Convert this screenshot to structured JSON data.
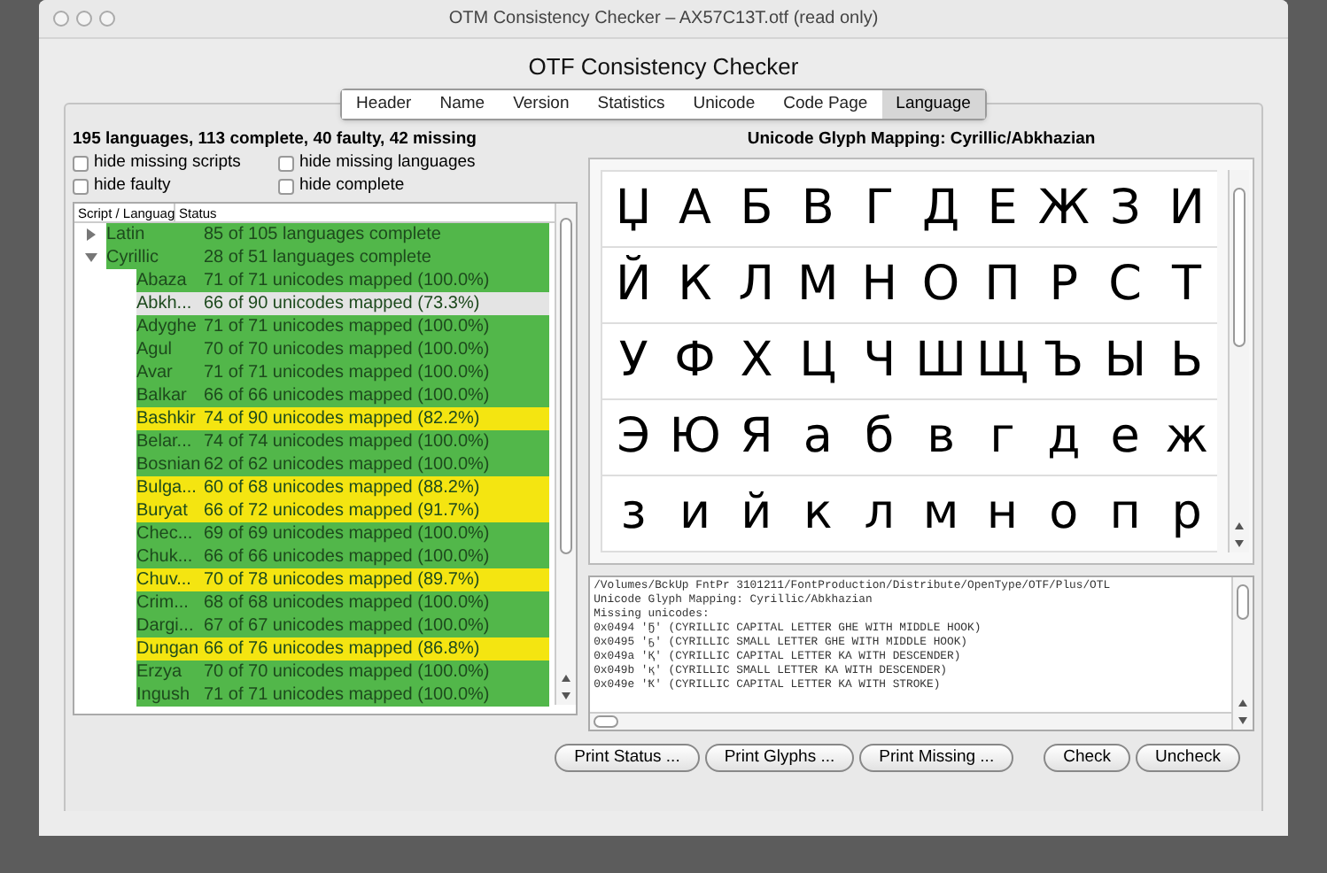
{
  "window": {
    "title": "OTM Consistency Checker – AX57C13T.otf (read only)"
  },
  "heading": "OTF Consistency Checker",
  "tabs": [
    {
      "label": "Header",
      "selected": false
    },
    {
      "label": "Name",
      "selected": false
    },
    {
      "label": "Version",
      "selected": false
    },
    {
      "label": "Statistics",
      "selected": false
    },
    {
      "label": "Unicode",
      "selected": false
    },
    {
      "label": "Code Page",
      "selected": false
    },
    {
      "label": "Language",
      "selected": true
    }
  ],
  "summary": "195 languages, 113 complete, 40 faulty, 42 missing",
  "filters": [
    {
      "label": "hide missing scripts",
      "checked": false
    },
    {
      "label": "hide missing languages",
      "checked": false
    },
    {
      "label": "hide faulty",
      "checked": false
    },
    {
      "label": "hide complete",
      "checked": false
    }
  ],
  "table": {
    "columns": [
      "Script / Languag",
      "Status"
    ],
    "rows": [
      {
        "name": "Latin",
        "status": "85 of 105 languages complete",
        "color": "#52b74a",
        "selected": false,
        "expanded": false,
        "children": []
      },
      {
        "name": "Cyrillic",
        "status": "28 of 51 languages complete",
        "color": "#52b74a",
        "selected": false,
        "expanded": true,
        "children": [
          {
            "name": "Abaza",
            "status": "71 of 71 unicodes mapped (100.0%)",
            "color": "#52b74a",
            "selected": false
          },
          {
            "name": "Abkh...",
            "status": "66 of 90 unicodes mapped (73.3%)",
            "selected": true
          },
          {
            "name": "Adyghe",
            "status": "71 of 71 unicodes mapped (100.0%)",
            "color": "#52b74a",
            "selected": false
          },
          {
            "name": "Agul",
            "status": "70 of 70 unicodes mapped (100.0%)",
            "color": "#52b74a",
            "selected": false
          },
          {
            "name": "Avar",
            "status": "71 of 71 unicodes mapped (100.0%)",
            "color": "#52b74a",
            "selected": false
          },
          {
            "name": "Balkar",
            "status": "66 of 66 unicodes mapped (100.0%)",
            "color": "#52b74a",
            "selected": false
          },
          {
            "name": "Bashkir",
            "status": "74 of 90 unicodes mapped (82.2%)",
            "color": "#f4e511",
            "selected": false
          },
          {
            "name": "Belar...",
            "status": "74 of 74 unicodes mapped (100.0%)",
            "color": "#52b74a",
            "selected": false
          },
          {
            "name": "Bosnian",
            "status": "62 of 62 unicodes mapped (100.0%)",
            "color": "#52b74a",
            "selected": false
          },
          {
            "name": "Bulga...",
            "status": "60 of 68 unicodes mapped (88.2%)",
            "color": "#f4e511",
            "selected": false
          },
          {
            "name": "Buryat",
            "status": "66 of 72 unicodes mapped (91.7%)",
            "color": "#f4e511",
            "selected": false
          },
          {
            "name": "Chec...",
            "status": "69 of 69 unicodes mapped (100.0%)",
            "color": "#52b74a",
            "selected": false
          },
          {
            "name": "Chuk...",
            "status": "66 of 66 unicodes mapped (100.0%)",
            "color": "#52b74a",
            "selected": false
          },
          {
            "name": "Chuv...",
            "status": "70 of 78 unicodes mapped (89.7%)",
            "color": "#f4e511",
            "selected": false
          },
          {
            "name": "Crim...",
            "status": "68 of 68 unicodes mapped (100.0%)",
            "color": "#52b74a",
            "selected": false
          },
          {
            "name": "Dargi...",
            "status": "67 of 67 unicodes mapped (100.0%)",
            "color": "#52b74a",
            "selected": false
          },
          {
            "name": "Dungan",
            "status": "66 of 76 unicodes mapped (86.8%)",
            "color": "#f4e511",
            "selected": false
          },
          {
            "name": "Erzya",
            "status": "70 of 70 unicodes mapped (100.0%)",
            "color": "#52b74a",
            "selected": false
          },
          {
            "name": "Ingush",
            "status": "71 of 71 unicodes mapped (100.0%)",
            "color": "#52b74a",
            "selected": false
          }
        ]
      }
    ]
  },
  "glyph_panel": {
    "title": "Unicode Glyph Mapping: Cyrillic/Abkhazian",
    "glyphs": [
      "Џ",
      "А",
      "Б",
      "В",
      "Г",
      "Д",
      "Е",
      "Ж",
      "З",
      "И",
      "Й",
      "К",
      "Л",
      "М",
      "Н",
      "О",
      "П",
      "Р",
      "С",
      "Т",
      "У",
      "Ф",
      "Х",
      "Ц",
      "Ч",
      "Ш",
      "Щ",
      "Ъ",
      "Ы",
      "Ь",
      "Э",
      "Ю",
      "Я",
      "а",
      "б",
      "в",
      "г",
      "д",
      "е",
      "ж",
      "з",
      "и",
      "й",
      "к",
      "л",
      "м",
      "н",
      "о",
      "п",
      "р"
    ]
  },
  "log": [
    "/Volumes/BckUp FntPr 3101211/FontProduction/Distribute/OpenType/OTF/Plus/OTL",
    "Unicode Glyph Mapping: Cyrillic/Abkhazian",
    "Missing unicodes:",
    "0x0494 'Ҕ' (CYRILLIC CAPITAL LETTER GHE WITH MIDDLE HOOK)",
    "0x0495 'ҕ' (CYRILLIC SMALL LETTER GHE WITH MIDDLE HOOK)",
    "0x049a 'Қ' (CYRILLIC CAPITAL LETTER KA WITH DESCENDER)",
    "0x049b 'қ' (CYRILLIC SMALL LETTER KA WITH DESCENDER)",
    "0x049e 'Ҟ' (CYRILLIC CAPITAL LETTER KA WITH STROKE)"
  ],
  "buttons": [
    "Print Status ...",
    "Print Glyphs ...",
    "Print Missing ...",
    "Check",
    "Uncheck"
  ]
}
